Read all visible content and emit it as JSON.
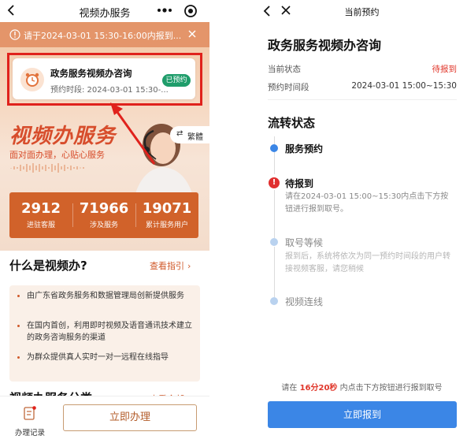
{
  "left": {
    "nav": {
      "title": "视频办服务"
    },
    "notice": {
      "text": "请于2024-03-01 15:30-16:00内报到..."
    },
    "appointment": {
      "name": "政务服务视频办咨询",
      "time": "预约时段: 2024-03-01 15:30-...",
      "badge": "已预约"
    },
    "hero": {
      "title": "视频办服务",
      "subtitle": "面对面办理，心贴心服务",
      "lang_switch": "繁體"
    },
    "stats": [
      {
        "value": "2912",
        "label": "进驻客服"
      },
      {
        "value": "71966",
        "label": "涉及服务"
      },
      {
        "value": "19071",
        "label": "累计服务用户"
      }
    ],
    "what_section": {
      "title": "什么是视频办?",
      "guide_link": "查看指引",
      "bullets": [
        "由广东省政务服务和数据管理局创新提供服务",
        "在国内首创，利用即时视频及语音通讯技术建立的政务咨询服务的渠道",
        "为群众提供真人实时一对一远程在线指导"
      ]
    },
    "next_section": {
      "title": "视频办服务分类",
      "more": "查看全部"
    },
    "bottom": {
      "records_label": "办理记录",
      "apply_button": "立即办理"
    }
  },
  "right": {
    "nav": {
      "title": "当前预约"
    },
    "title": "政务服务视频办咨询",
    "status_label": "当前状态",
    "status_value": "待报到",
    "period_label": "预约时间段",
    "period_value": "2024-03-01 15:00~15:30",
    "flow_title": "流转状态",
    "steps": [
      {
        "name": "服务预约",
        "desc": ""
      },
      {
        "name": "待报到",
        "desc": "请在2024-03-01 15:00~15:30内点击下方按钮进行报到取号。"
      },
      {
        "name": "取号等候",
        "desc": "报到后，系统将依次为同一预约时间段的用户转接视频客服，请您稍候"
      },
      {
        "name": "视频连线",
        "desc": ""
      }
    ],
    "tip_prefix": "请在",
    "tip_highlight": "16分20秒",
    "tip_suffix": "内点击下方按钮进行报到取号",
    "button": "立即报到"
  },
  "colors": {
    "accent_orange": "#d1622a",
    "highlight_red": "#e0221c",
    "primary_blue": "#3b86e6",
    "badge_green": "#1f9d6b"
  }
}
